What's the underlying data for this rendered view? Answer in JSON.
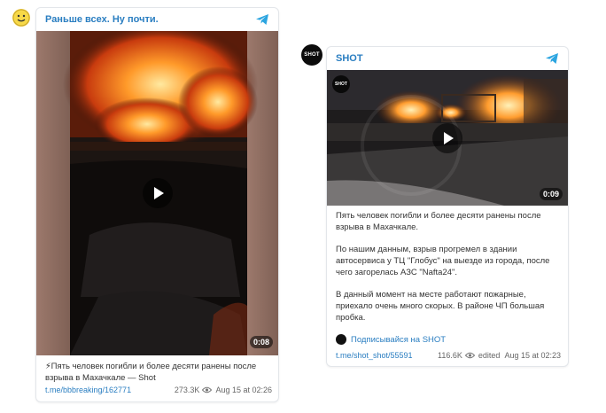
{
  "post1": {
    "channel": "Раньше всех. Ну почти.",
    "duration": "0:08",
    "caption_line1": "⚡Пять человек погибли и более десяти ранены после",
    "caption_line2": "взрыва в Махачкале — Shot",
    "link": "t.me/bbbreaking/162771",
    "views": "273.3K",
    "date": "Aug 15 at 02:26"
  },
  "post2": {
    "channel": "SHOT",
    "avatar_text": "SHOT",
    "duration": "0:09",
    "p1_line1": "Пять человек погибли и более десяти ранены после",
    "p1_line2": "взрыва в Махачкале.",
    "p2_line1": "По нашим данным, взрыв прогремел в здании",
    "p2_line2": "автосервиса у ТЦ \"Глобус\" на выезде из города, после",
    "p2_line3": "чего загорелась АЗС \"Nafta24\".",
    "p3_line1": "В данный момент на месте работают пожарные,",
    "p3_line2": "приехало очень много скорых. В районе ЧП большая",
    "p3_line3": "пробка.",
    "subscribe": "Подписывайся на SHOT",
    "link": "t.me/shot_shot/55591",
    "views": "116.6K",
    "edited": "edited",
    "date": "Aug 15 at 02:23"
  },
  "colors": {
    "accent": "#2a7ec1",
    "telegram": "#2ca5e0"
  },
  "icons": [
    "telegram-icon",
    "play-icon",
    "eye-icon"
  ]
}
